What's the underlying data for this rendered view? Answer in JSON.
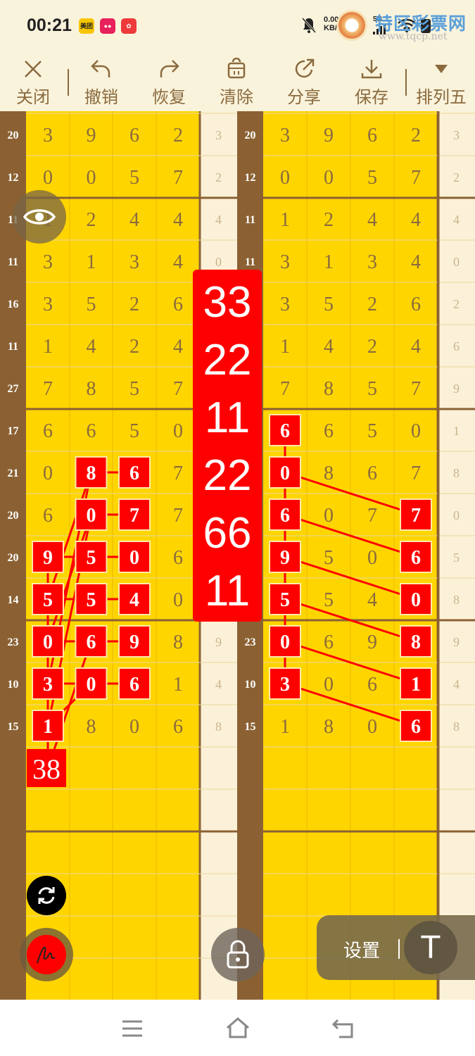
{
  "status": {
    "time": "00:21",
    "net_top": "0.00",
    "net_bottom": "KB/s",
    "sig1": "5G",
    "sig2": "5G"
  },
  "app_icons": [
    {
      "label": "美团",
      "color": "#f7c600",
      "text_color": "#222"
    },
    {
      "label": "",
      "color": "#e8205b",
      "text_color": "#fff"
    },
    {
      "label": "",
      "color": "#ee3a3a",
      "text_color": "#fff"
    }
  ],
  "watermark": {
    "title": "特区彩票网",
    "url": "www.tqcp.net"
  },
  "toolbar": [
    {
      "label": "关闭",
      "icon": "close-icon"
    },
    {
      "label": "撤销",
      "icon": "undo-icon"
    },
    {
      "label": "恢复",
      "icon": "redo-icon"
    },
    {
      "label": "清除",
      "icon": "trash-icon"
    },
    {
      "label": "分享",
      "icon": "share-icon"
    },
    {
      "label": "保存",
      "icon": "download-icon"
    },
    {
      "label": "排列五",
      "icon": "triangle-down-icon"
    }
  ],
  "grid": {
    "rows": [
      {
        "id": "20",
        "d": [
          3,
          9,
          6,
          2
        ],
        "e": "3"
      },
      {
        "id": "12",
        "d": [
          0,
          0,
          5,
          7
        ],
        "e": "2"
      },
      {
        "id": "11",
        "d": [
          1,
          2,
          4,
          4
        ],
        "e": "4"
      },
      {
        "id": "11",
        "d": [
          3,
          1,
          3,
          4
        ],
        "e": "0"
      },
      {
        "id": "16",
        "d": [
          3,
          5,
          2,
          6
        ],
        "e": "2"
      },
      {
        "id": "11",
        "d": [
          1,
          4,
          2,
          4
        ],
        "e": "6"
      },
      {
        "id": "27",
        "d": [
          7,
          8,
          5,
          7
        ],
        "e": "9"
      },
      {
        "id": "17",
        "d": [
          6,
          6,
          5,
          0
        ],
        "e": "1"
      },
      {
        "id": "21",
        "d": [
          0,
          8,
          6,
          7
        ],
        "e": "8"
      },
      {
        "id": "20",
        "d": [
          6,
          0,
          7,
          7
        ],
        "e": "0"
      },
      {
        "id": "20",
        "d": [
          9,
          5,
          0,
          6
        ],
        "e": "5"
      },
      {
        "id": "14",
        "d": [
          5,
          5,
          4,
          0
        ],
        "e": "8"
      },
      {
        "id": "23",
        "d": [
          0,
          6,
          9,
          8
        ],
        "e": "9"
      },
      {
        "id": "10",
        "d": [
          3,
          0,
          6,
          1
        ],
        "e": "4"
      },
      {
        "id": "15",
        "d": [
          1,
          8,
          0,
          6
        ],
        "e": "8"
      }
    ],
    "empty_rows": 6,
    "left_marks": [
      {
        "r": 8,
        "c": 1
      },
      {
        "r": 8,
        "c": 2
      },
      {
        "r": 9,
        "c": 1
      },
      {
        "r": 9,
        "c": 2
      },
      {
        "r": 10,
        "c": 0
      },
      {
        "r": 10,
        "c": 1
      },
      {
        "r": 10,
        "c": 2
      },
      {
        "r": 11,
        "c": 0
      },
      {
        "r": 11,
        "c": 1
      },
      {
        "r": 11,
        "c": 2
      },
      {
        "r": 12,
        "c": 0
      },
      {
        "r": 12,
        "c": 1
      },
      {
        "r": 12,
        "c": 2
      },
      {
        "r": 13,
        "c": 0
      },
      {
        "r": 13,
        "c": 1
      },
      {
        "r": 13,
        "c": 2
      },
      {
        "r": 14,
        "c": 0
      }
    ],
    "left_lines": [
      [
        [
          8,
          1
        ],
        [
          8,
          2
        ]
      ],
      [
        [
          9,
          1
        ],
        [
          9,
          2
        ]
      ],
      [
        [
          10,
          0
        ],
        [
          10,
          1
        ]
      ],
      [
        [
          10,
          1
        ],
        [
          10,
          2
        ]
      ],
      [
        [
          11,
          0
        ],
        [
          11,
          1
        ]
      ],
      [
        [
          11,
          1
        ],
        [
          11,
          2
        ]
      ],
      [
        [
          12,
          0
        ],
        [
          12,
          1
        ]
      ],
      [
        [
          12,
          1
        ],
        [
          12,
          2
        ]
      ],
      [
        [
          13,
          0
        ],
        [
          13,
          1
        ]
      ],
      [
        [
          13,
          1
        ],
        [
          13,
          2
        ]
      ],
      [
        [
          15,
          0
        ],
        [
          10,
          0
        ]
      ],
      [
        [
          14,
          0
        ],
        [
          9,
          1
        ]
      ],
      [
        [
          13,
          0
        ],
        [
          8,
          1
        ]
      ],
      [
        [
          12,
          0
        ],
        [
          9,
          1
        ]
      ],
      [
        [
          11,
          0
        ],
        [
          8,
          1
        ]
      ],
      [
        [
          15,
          0
        ],
        [
          12,
          1
        ]
      ],
      [
        [
          14,
          0
        ],
        [
          13,
          1
        ]
      ]
    ],
    "left_note": {
      "r": 15,
      "c": 0,
      "text": "38"
    },
    "right_marks": [
      {
        "r": 7,
        "c": 0
      },
      {
        "r": 8,
        "c": 0
      },
      {
        "r": 9,
        "c": 0
      },
      {
        "r": 10,
        "c": 0
      },
      {
        "r": 11,
        "c": 0
      },
      {
        "r": 12,
        "c": 0
      },
      {
        "r": 13,
        "c": 0
      },
      {
        "r": 9,
        "c": 3
      },
      {
        "r": 10,
        "c": 3
      },
      {
        "r": 11,
        "c": 3
      },
      {
        "r": 12,
        "c": 3
      },
      {
        "r": 13,
        "c": 3
      },
      {
        "r": 14,
        "c": 3
      }
    ],
    "right_lines": [
      [
        [
          7,
          0
        ],
        [
          13,
          0
        ]
      ],
      [
        [
          8,
          0
        ],
        [
          9,
          3
        ]
      ],
      [
        [
          9,
          0
        ],
        [
          10,
          3
        ]
      ],
      [
        [
          10,
          0
        ],
        [
          11,
          3
        ]
      ],
      [
        [
          11,
          0
        ],
        [
          12,
          3
        ]
      ],
      [
        [
          12,
          0
        ],
        [
          13,
          3
        ]
      ],
      [
        [
          13,
          0
        ],
        [
          14,
          3
        ]
      ]
    ]
  },
  "center_panel": {
    "numbers": [
      "33",
      "22",
      "11",
      "22",
      "66",
      "11"
    ]
  },
  "floating": {
    "settings_label": "设置",
    "text_tool_label": "T"
  },
  "colors": {
    "yellow": "#ffd500",
    "brown": "#8b6133",
    "cream": "#fbf1d8",
    "mark_red": "#ff0000",
    "digit": "#8a6a3e",
    "panel_red": "#ff0000"
  }
}
